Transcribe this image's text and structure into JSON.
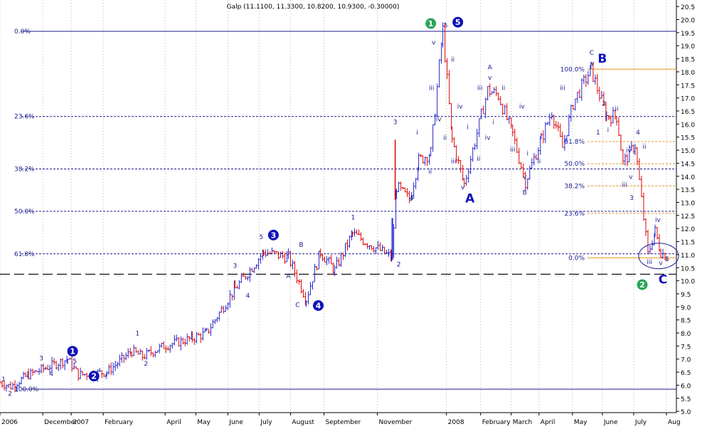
{
  "chart_data": {
    "type": "ohlc",
    "title": "Galp (11.1100, 11.3300, 10.8200, 10.9300, -0.30000)",
    "y_axis": {
      "range": [
        4.95,
        20.75
      ],
      "ticks": [
        "20.5",
        "20.0",
        "19.5",
        "19.0",
        "18.5",
        "18.0",
        "17.5",
        "17.0",
        "16.5",
        "16.0",
        "15.5",
        "15.0",
        "14.5",
        "14.0",
        "13.5",
        "13.0",
        "12.5",
        "12.0",
        "11.5",
        "11.0",
        "10.5",
        "10.0",
        "9.5",
        "9.0",
        "8.5",
        "8.0",
        "7.5",
        "7.0",
        "6.5",
        "6.0",
        "5.5",
        "5.0"
      ]
    },
    "x_axis": {
      "labels": [
        "2006",
        "December",
        "2007",
        "February",
        "April",
        "May",
        "June",
        "July",
        "August",
        "September",
        "November",
        "2008",
        "February",
        "March",
        "April",
        "May",
        "June",
        "July",
        "Aug"
      ],
      "label_index": [
        0,
        60,
        100,
        145,
        232,
        275,
        320,
        364,
        408,
        455,
        530,
        627,
        675,
        718,
        757,
        804,
        846,
        890,
        936
      ]
    },
    "grid": true,
    "colors": {
      "up": "#2222cc",
      "down": "#dd0000",
      "fib": "#1a1a8c",
      "fib_right": "#e8952c",
      "wave_green": "#2aa55a",
      "wave_blue": "#1111bb"
    },
    "series": [
      {
        "anchors_idx": [
          0,
          15,
          40,
          95,
          110,
          150,
          185,
          200,
          230,
          270,
          290,
          330,
          345,
          370,
          405,
          430,
          450,
          470,
          495,
          550,
          557,
          575,
          588,
          605,
          622,
          635,
          652,
          685,
          700,
          720,
          738,
          760,
          775,
          790,
          805,
          830,
          852,
          866,
          875,
          892,
          910,
          920,
          928,
          936
        ],
        "anchors_price": [
          6.1,
          5.95,
          6.4,
          7.0,
          6.4,
          6.5,
          7.3,
          7.1,
          7.5,
          7.8,
          8.0,
          9.7,
          10.2,
          11.1,
          10.9,
          9.3,
          11.1,
          10.4,
          11.8,
          10.9,
          13.6,
          13.1,
          14.6,
          14.9,
          19.6,
          15.4,
          13.7,
          17.3,
          17.1,
          15.6,
          13.8,
          15.4,
          16.5,
          15.1,
          16.8,
          18.1,
          16.3,
          16.3,
          14.5,
          15.2,
          11.0,
          11.9,
          11.1,
          10.93
        ]
      }
    ],
    "fib_left": [
      {
        "label": "0.0%",
        "price": 19.55
      },
      {
        "label": "23.6%",
        "price": 16.29
      },
      {
        "label": "38.2%",
        "price": 14.28
      },
      {
        "label": "50.0%",
        "price": 12.66
      },
      {
        "label": "61.8%",
        "price": 11.03
      },
      {
        "label": "100.0%",
        "price": 5.85
      }
    ],
    "fib_right": [
      {
        "label": "100.0%",
        "price": 18.1
      },
      {
        "label": "61.8%",
        "price": 15.33
      },
      {
        "label": "50.0%",
        "price": 14.48
      },
      {
        "label": "38.2%",
        "price": 13.63
      },
      {
        "label": "23.6%",
        "price": 12.58
      },
      {
        "label": "0.0%",
        "price": 10.88
      }
    ],
    "support_line": {
      "price": 10.25
    },
    "annotations_small": [
      {
        "t": "1",
        "i": 5,
        "p": 6.15
      },
      {
        "t": "2",
        "i": 14,
        "p": 5.6
      },
      {
        "t": "3",
        "i": 58,
        "p": 6.95
      },
      {
        "t": "4",
        "i": 72,
        "p": 6.35
      },
      {
        "t": "5",
        "i": 105,
        "p": 6.85
      },
      {
        "t": "1",
        "i": 193,
        "p": 7.9
      },
      {
        "t": "2",
        "i": 205,
        "p": 6.75
      },
      {
        "t": "3",
        "i": 330,
        "p": 10.5
      },
      {
        "t": "4",
        "i": 348,
        "p": 9.35
      },
      {
        "t": "5",
        "i": 367,
        "p": 11.6
      },
      {
        "t": "A",
        "i": 405,
        "p": 10.1
      },
      {
        "t": "B",
        "i": 423,
        "p": 11.3
      },
      {
        "t": "C",
        "i": 418,
        "p": 9.0
      },
      {
        "t": "1",
        "i": 496,
        "p": 12.35
      },
      {
        "t": "2",
        "i": 560,
        "p": 10.55
      },
      {
        "t": "3",
        "i": 555,
        "p": 16.0
      },
      {
        "t": "4",
        "i": 578,
        "p": 13.1
      },
      {
        "t": "5",
        "i": 626,
        "p": 19.7
      },
      {
        "t": "v",
        "i": 609,
        "p": 19.05
      },
      {
        "t": "iii",
        "i": 606,
        "p": 17.3
      },
      {
        "t": "iv",
        "i": 616,
        "p": 16.1
      },
      {
        "t": "ii",
        "i": 604,
        "p": 14.1
      },
      {
        "t": "i",
        "i": 586,
        "p": 15.6
      },
      {
        "t": "ii",
        "i": 636,
        "p": 18.4
      },
      {
        "t": "iv",
        "i": 646,
        "p": 16.6
      },
      {
        "t": "iii",
        "i": 637,
        "p": 14.5
      },
      {
        "t": "ii",
        "i": 625,
        "p": 15.4
      },
      {
        "t": "i",
        "i": 657,
        "p": 15.8
      },
      {
        "t": "iii",
        "i": 674,
        "p": 17.3
      },
      {
        "t": "A",
        "i": 688,
        "p": 18.1
      },
      {
        "t": "v",
        "i": 688,
        "p": 17.7
      },
      {
        "t": "iv",
        "i": 685,
        "p": 15.4
      },
      {
        "t": "i",
        "i": 693,
        "p": 16.0
      },
      {
        "t": "ii",
        "i": 707,
        "p": 17.3
      },
      {
        "t": "ii",
        "i": 672,
        "p": 14.6
      },
      {
        "t": "iv",
        "i": 733,
        "p": 16.6
      },
      {
        "t": "iii",
        "i": 720,
        "p": 14.95
      },
      {
        "t": "ii",
        "i": 757,
        "p": 14.5
      },
      {
        "t": "i",
        "i": 741,
        "p": 14.8
      },
      {
        "t": "v",
        "i": 650,
        "p": 13.5
      },
      {
        "t": "v",
        "i": 737,
        "p": 13.9
      },
      {
        "t": "B",
        "i": 737,
        "p": 13.3
      },
      {
        "t": "iii",
        "i": 790,
        "p": 17.3
      },
      {
        "t": "C",
        "i": 831,
        "p": 18.65
      },
      {
        "t": "v",
        "i": 832,
        "p": 18.25
      },
      {
        "t": "2",
        "i": 848,
        "p": 16.7
      },
      {
        "t": "ii",
        "i": 866,
        "p": 16.5
      },
      {
        "t": "1",
        "i": 840,
        "p": 15.6
      },
      {
        "t": "i",
        "i": 854,
        "p": 15.7
      },
      {
        "t": "4",
        "i": 896,
        "p": 15.6
      },
      {
        "t": "iv",
        "i": 883,
        "p": 14.9
      },
      {
        "t": "ii",
        "i": 905,
        "p": 15.05
      },
      {
        "t": "iii",
        "i": 877,
        "p": 13.6
      },
      {
        "t": "v",
        "i": 886,
        "p": 13.9
      },
      {
        "t": "3",
        "i": 887,
        "p": 13.1
      },
      {
        "t": "iv",
        "i": 924,
        "p": 12.25
      },
      {
        "t": "iii",
        "i": 912,
        "p": 10.65
      },
      {
        "t": "v",
        "i": 928,
        "p": 10.6
      },
      {
        "t": "5",
        "i": 937,
        "p": 10.75
      }
    ],
    "annotations_circled": [
      {
        "t": "1",
        "i": 102,
        "p": 7.3,
        "color": "wave_blue"
      },
      {
        "t": "2",
        "i": 132,
        "p": 6.35,
        "color": "wave_blue"
      },
      {
        "t": "3",
        "i": 384,
        "p": 11.75,
        "color": "wave_blue"
      },
      {
        "t": "4",
        "i": 447,
        "p": 9.05,
        "color": "wave_blue"
      },
      {
        "t": "5",
        "i": 643,
        "p": 19.9,
        "color": "wave_blue"
      },
      {
        "t": "1",
        "i": 605,
        "p": 19.85,
        "color": "wave_green"
      },
      {
        "t": "2",
        "i": 902,
        "p": 9.85,
        "color": "wave_green"
      }
    ],
    "annotations_large": [
      {
        "t": "A",
        "i": 660,
        "p": 13.0
      },
      {
        "t": "B",
        "i": 846,
        "p": 18.35
      },
      {
        "t": "C",
        "i": 931,
        "p": 9.9
      }
    ]
  }
}
